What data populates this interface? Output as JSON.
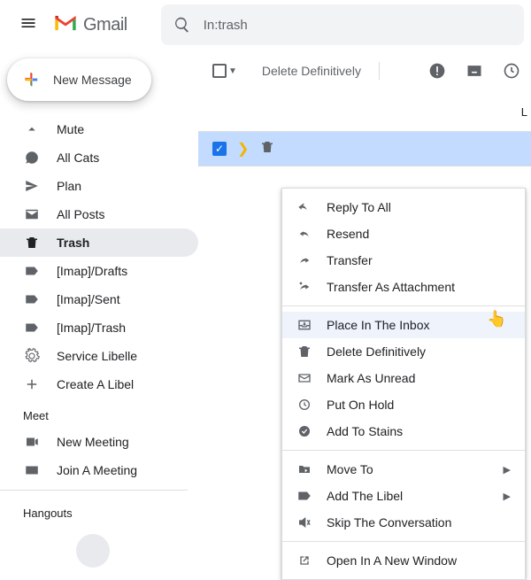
{
  "header": {
    "product": "Gmail",
    "search_value": "In:trash"
  },
  "compose_label": "New Message",
  "nav": [
    {
      "icon": "less",
      "label": "Mute"
    },
    {
      "icon": "chat",
      "label": "All Cats"
    },
    {
      "icon": "send",
      "label": "Plan"
    },
    {
      "icon": "mail",
      "label": "All Posts"
    },
    {
      "icon": "trash",
      "label": "Trash",
      "active": true
    },
    {
      "icon": "label",
      "label": "[Imap]/Drafts"
    },
    {
      "icon": "label",
      "label": "[Imap]/Sent"
    },
    {
      "icon": "label",
      "label": "[Imap]/Trash"
    },
    {
      "icon": "settings",
      "label": "Service Libelle"
    },
    {
      "icon": "plus",
      "label": "Create A Libel"
    }
  ],
  "meet": {
    "title": "Meet",
    "new": "New Meeting",
    "join": "Join A Meeting"
  },
  "hangouts_title": "Hangouts",
  "toolbar": {
    "delete_label": "Delete Definitively"
  },
  "banner_right": "L",
  "ctx": [
    {
      "icon": "reply-all",
      "label": "Reply To All"
    },
    {
      "icon": "reply",
      "label": "Resend"
    },
    {
      "icon": "forward",
      "label": "Transfer"
    },
    {
      "icon": "attach-fwd",
      "label": "Transfer As Attachment"
    },
    {
      "sep": true
    },
    {
      "icon": "inbox",
      "label": "Place In The Inbox",
      "hover": true
    },
    {
      "icon": "trash",
      "label": "Delete Definitively"
    },
    {
      "icon": "unread",
      "label": "Mark As Unread"
    },
    {
      "icon": "clock",
      "label": "Put On Hold"
    },
    {
      "icon": "add-task",
      "label": "Add To Stains"
    },
    {
      "sep": true
    },
    {
      "icon": "folder",
      "label": "Move To",
      "sub": "▶"
    },
    {
      "icon": "label",
      "label": "Add The Libel",
      "sub": "▶"
    },
    {
      "icon": "mute",
      "label": "Skip The Conversation"
    },
    {
      "sep": true
    },
    {
      "icon": "open",
      "label": "Open In A New Window"
    }
  ]
}
